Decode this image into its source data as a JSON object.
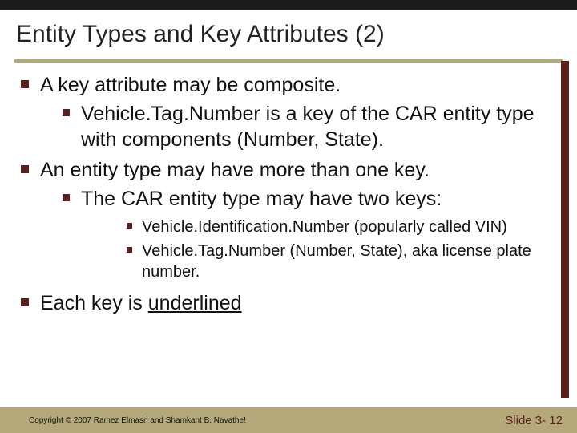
{
  "title": "Entity Types and Key Attributes (2)",
  "bullets": {
    "b1": "A key attribute may be composite.",
    "b1_1": "Vehicle.Tag.Number is a key of the CAR entity type with components (Number, State).",
    "b2": "An entity type may have more than one key.",
    "b2_1": "The CAR entity type may have two keys:",
    "b2_1_1": "Vehicle.Identification.Number (popularly called VIN)",
    "b2_1_2": "Vehicle.Tag.Number (Number, State), aka license plate number.",
    "b3_pre": "Each key is ",
    "b3_u": "underlined"
  },
  "footer": {
    "copyright": "Copyright © 2007 Ramez Elmasri and Shamkant B. Navathe!",
    "slide": "Slide 3- 12"
  }
}
